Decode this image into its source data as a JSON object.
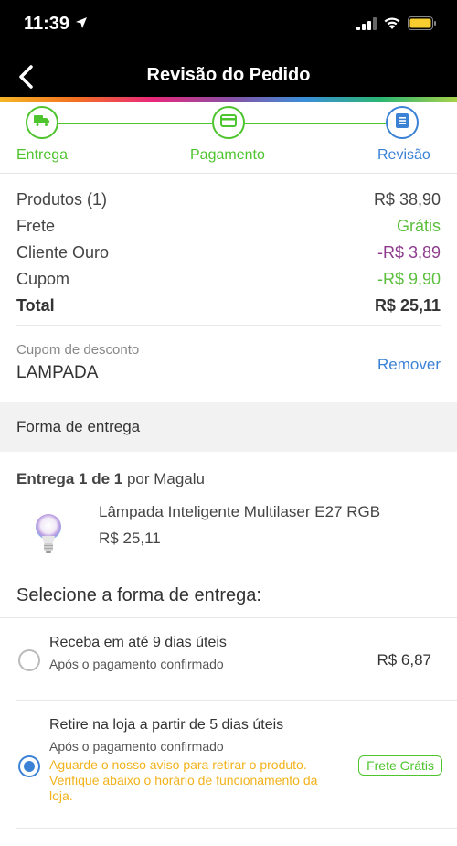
{
  "status_bar": {
    "time": "11:39"
  },
  "nav": {
    "title": "Revisão do Pedido"
  },
  "stepper": {
    "steps": [
      {
        "label": "Entrega",
        "state": "done"
      },
      {
        "label": "Pagamento",
        "state": "done"
      },
      {
        "label": "Revisão",
        "state": "current"
      }
    ]
  },
  "summary": {
    "rows": [
      {
        "label": "Produtos (1)",
        "value": "R$ 38,90"
      },
      {
        "label": "Frete",
        "value": "Grátis"
      },
      {
        "label": "Cliente Ouro",
        "value": "-R$ 3,89"
      },
      {
        "label": "Cupom",
        "value": "-R$ 9,90"
      },
      {
        "label": "Total",
        "value": "R$ 25,11"
      }
    ]
  },
  "coupon": {
    "label": "Cupom de desconto",
    "code": "LAMPADA",
    "remove_label": "Remover"
  },
  "delivery_section": {
    "header": "Forma de entrega",
    "shipment_prefix": "Entrega 1 de 1",
    "shipment_suffix": " por Magalu",
    "product": {
      "name": "Lâmpada Inteligente Multilaser E27 RGB",
      "price": "R$ 25,11"
    },
    "select_title": "Selecione a forma de entrega:",
    "options": [
      {
        "title": "Receba em até 9 dias úteis",
        "subtitle": "Após o pagamento confirmado",
        "price": "R$ 6,87",
        "selected": false
      },
      {
        "title": "Retire na loja a partir de 5 dias úteis",
        "subtitle": "Após o pagamento confirmado",
        "notice": "Aguarde o nosso aviso para retirar o produto. Verifique abaixo o horário de funcionamento da loja.",
        "badge": "Frete Grátis",
        "selected": true
      }
    ]
  },
  "colors": {
    "accent_green": "#4ec42e",
    "accent_blue": "#3b82d6",
    "discount_purple": "#8e3a8c",
    "notice_yellow": "#f2b21b"
  }
}
